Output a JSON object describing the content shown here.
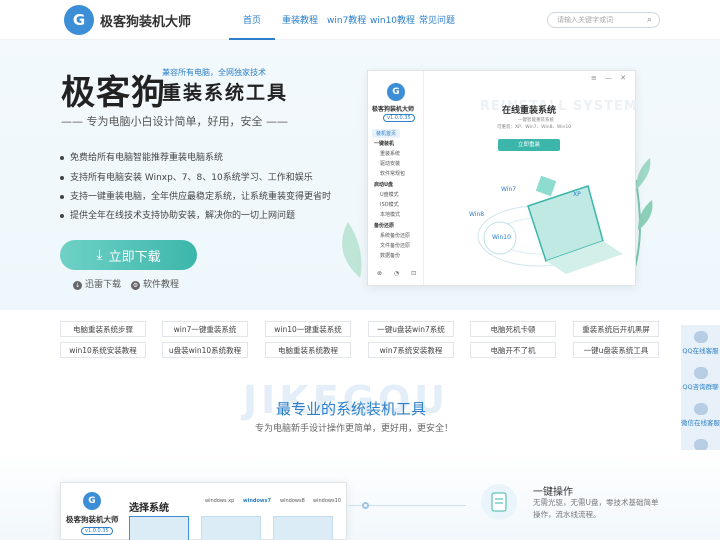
{
  "header": {
    "logo_glyph": "G",
    "brand": "极客狗装机大师",
    "nav": [
      "首页",
      "重装教程",
      "win7教程",
      "win10教程",
      "常见问题"
    ],
    "search_placeholder": "请输入关键字或词",
    "accent": "#2c7fc8"
  },
  "hero": {
    "title": "极客狗",
    "small_text": "兼容所有电脑，全网独家技术",
    "subtitle": "重装系统工具",
    "slogan": "——  专为电脑小白设计简单，好用，安全  ——",
    "features": [
      "免费给所有电脑智能推荐重装电脑系统",
      "支持所有电脑安装 Winxp、7、8、10系统学习、工作和娱乐",
      "支持一键重装电脑，全年供应最稳定系统，让系统重装变得更省时",
      "提供全年在线技术支持协助安装，解决你的一切上网问题"
    ],
    "download_label": "立即下载",
    "thunder_label": "迅雷下载",
    "tutorial_label": "软件教程",
    "button_color": "#3cb6aa"
  },
  "app_preview": {
    "logo_glyph": "G",
    "name": "极客狗装机大师",
    "version": "v1.0.0.35",
    "menu": [
      {
        "label": "装机首页",
        "type": "active"
      },
      {
        "label": "一键装机",
        "type": "group"
      },
      {
        "label": "重装系统",
        "type": "item"
      },
      {
        "label": "驱动安装",
        "type": "item"
      },
      {
        "label": "软件常规包",
        "type": "item"
      },
      {
        "label": "启动U盘",
        "type": "group"
      },
      {
        "label": "U盘模式",
        "type": "item"
      },
      {
        "label": "ISO模式",
        "type": "item"
      },
      {
        "label": "本地模式",
        "type": "item"
      },
      {
        "label": "备份还原",
        "type": "group"
      },
      {
        "label": "系统备份还原",
        "type": "item"
      },
      {
        "label": "文件备份还原",
        "type": "item"
      },
      {
        "label": "数据备份",
        "type": "item"
      }
    ],
    "window_controls": "≡ — ✕",
    "ghost_text": "REINSTALL SYSTEM",
    "title": "在线重装系统",
    "desc1": "一键智能重装系统",
    "desc2": "可重装：XP、Win7、Win8、Win10",
    "button": "立即重装",
    "tags": [
      "Win7",
      "Win8",
      "Win10",
      "XP"
    ],
    "bottom_icons": "⊗ ◔ ⊡"
  },
  "links": [
    "电脑重装系统步骤",
    "win7一键重装系统",
    "win10一键重装系统",
    "一键u盘装win7系统",
    "电脑死机卡顿",
    "重装系统后开机黑屏",
    "win10系统安装教程",
    "u盘装win10系统教程",
    "电脑重装系统教程",
    "win7系统安装教程",
    "电脑开不了机",
    "一键u盘装系统工具"
  ],
  "side_float": [
    "QQ在线客服",
    "QQ咨询群聊",
    "微信在线客服",
    "置顶"
  ],
  "section": {
    "ghost": "JIKEGOU",
    "title": "最专业的系统装机工具",
    "subtitle": "专为电脑新手设计操作更简单，更好用，更安全！"
  },
  "app_preview2": {
    "logo_glyph": "G",
    "name": "极客狗装机大师",
    "version": "v1.0.0.35",
    "title": "选择系统",
    "tabs": [
      "windows xp",
      "windows7",
      "windows8",
      "windows10"
    ]
  },
  "operation": {
    "title": "一键操作",
    "desc": "无需光驱，无需U盘，零技术基础简单操作，流水线流程。"
  }
}
